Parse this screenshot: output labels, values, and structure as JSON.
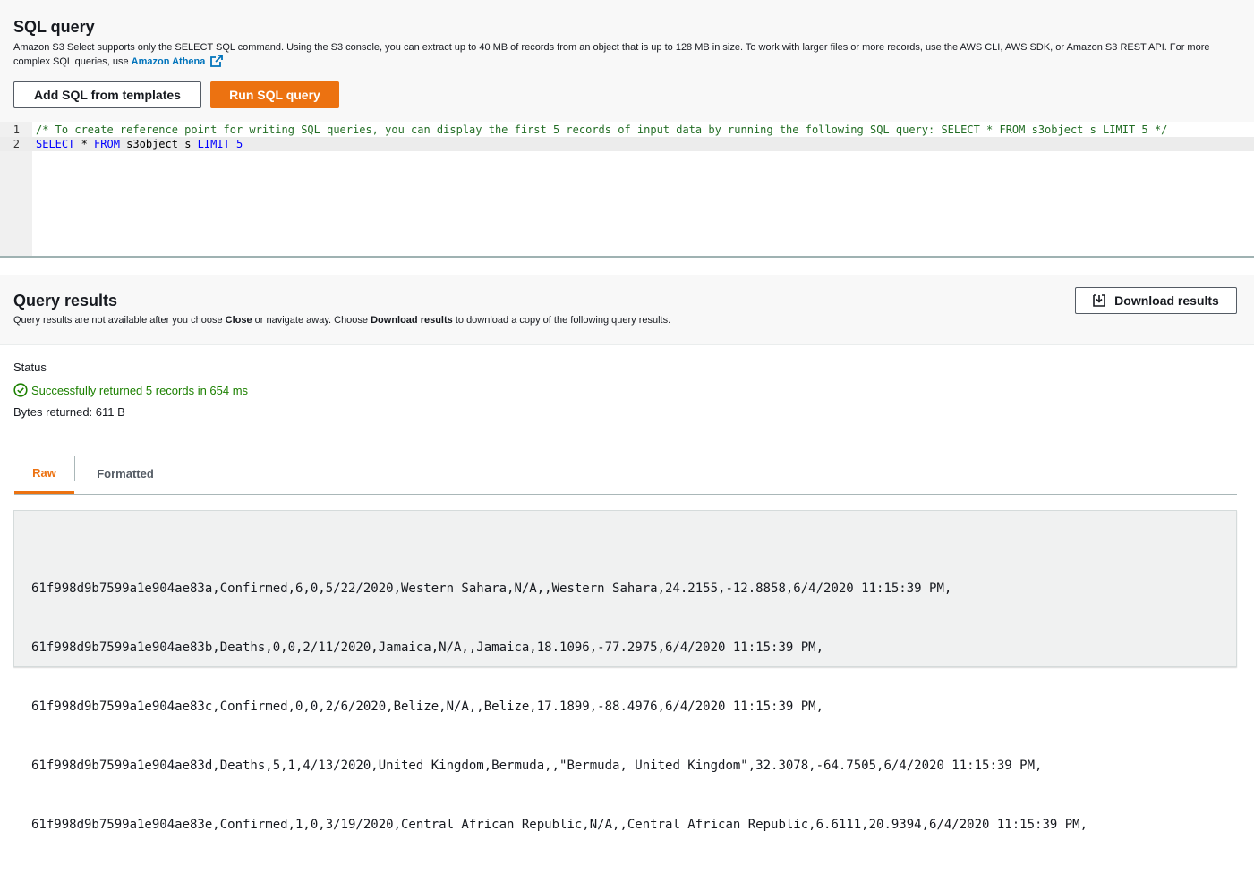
{
  "sql_query": {
    "title": "SQL query",
    "description_text": "Amazon S3 Select supports only the SELECT SQL command. Using the S3 console, you can extract up to 40 MB of records from an object that is up to 128 MB in size. To work with larger files or more records, use the AWS CLI, AWS SDK, or Amazon S3 REST API. For more complex SQL queries, use ",
    "athena_link": "Amazon Athena",
    "add_templates_label": "Add SQL from templates",
    "run_label": "Run SQL query",
    "accent_color": "#ec7211",
    "link_color": "#0073bb"
  },
  "editor": {
    "lines": [
      {
        "number": "1",
        "comment": "/* To create reference point for writing SQL queries, you can display the first 5 records of input data by running the following SQL query: SELECT * FROM s3object s LIMIT 5 */"
      },
      {
        "number": "2",
        "kw_select": "SELECT",
        "star": " * ",
        "kw_from": "FROM",
        "table": " s3object s ",
        "kw_limit": "LIMIT",
        "limit_value": " 5"
      }
    ]
  },
  "results": {
    "title": "Query results",
    "desc_prefix": "Query results are not available after you choose ",
    "desc_close": "Close",
    "desc_middle": " or navigate away. Choose ",
    "desc_download": "Download results",
    "desc_suffix": " to download a copy of the following query results.",
    "download_label": "Download results",
    "status_label": "Status",
    "status_value": "Successfully returned 5 records in 654 ms",
    "status_color": "#1d8102",
    "bytes_returned": "Bytes returned: 611 B",
    "tabs": [
      {
        "label": "Raw",
        "active": true
      },
      {
        "label": "Formatted",
        "active": false
      }
    ],
    "raw_lines": [
      "61f998d9b7599a1e904ae83a,Confirmed,6,0,5/22/2020,Western Sahara,N/A,,Western Sahara,24.2155,-12.8858,6/4/2020 11:15:39 PM,",
      "61f998d9b7599a1e904ae83b,Deaths,0,0,2/11/2020,Jamaica,N/A,,Jamaica,18.1096,-77.2975,6/4/2020 11:15:39 PM,",
      "61f998d9b7599a1e904ae83c,Confirmed,0,0,2/6/2020,Belize,N/A,,Belize,17.1899,-88.4976,6/4/2020 11:15:39 PM,",
      "61f998d9b7599a1e904ae83d,Deaths,5,1,4/13/2020,United Kingdom,Bermuda,,\"Bermuda, United Kingdom\",32.3078,-64.7505,6/4/2020 11:15:39 PM,",
      "61f998d9b7599a1e904ae83e,Confirmed,1,0,3/19/2020,Central African Republic,N/A,,Central African Republic,6.6111,20.9394,6/4/2020 11:15:39 PM,"
    ]
  }
}
